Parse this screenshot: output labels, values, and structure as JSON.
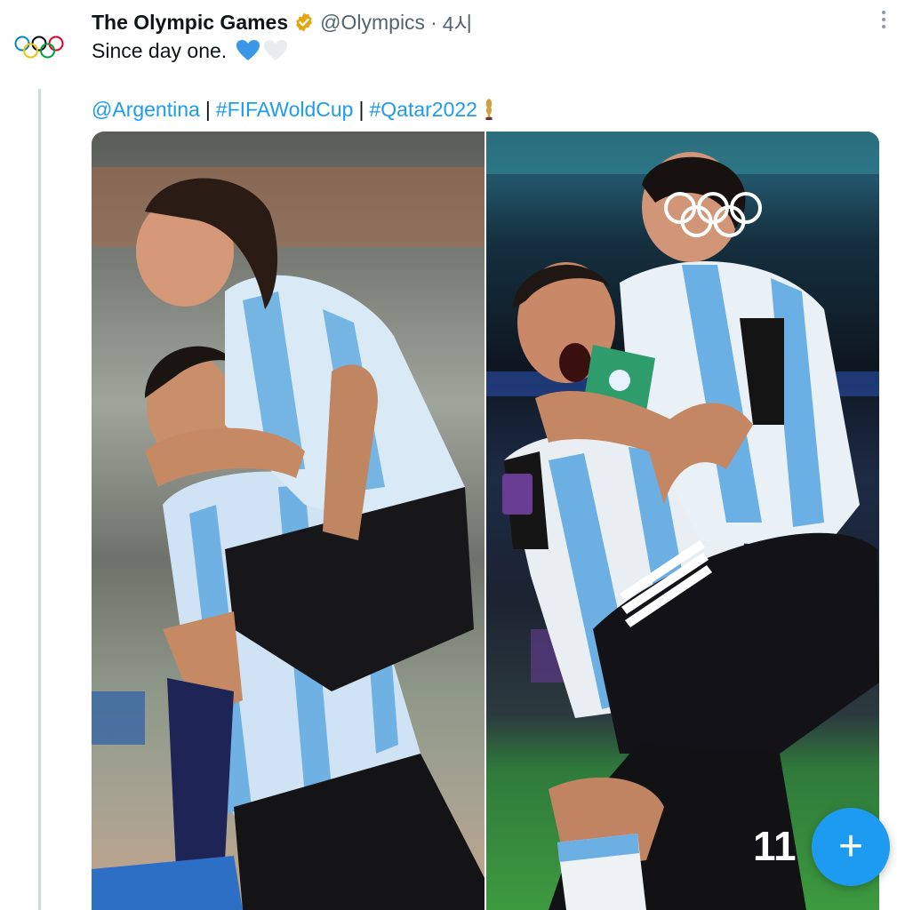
{
  "tweet": {
    "author_name": "The Olympic Games",
    "handle": "@Olympics",
    "separator": "·",
    "time": "4시",
    "text": "Since day one.",
    "emoji_hearts": [
      "blue-heart-icon",
      "white-heart-icon"
    ],
    "mentions": [
      {
        "label": "@Argentina"
      },
      {
        "label": "#FIFAWoldCup"
      },
      {
        "label": "#Qatar2022"
      }
    ],
    "pipe": "|"
  },
  "media": {
    "photos": [
      {
        "name": "photo-2008-celebration"
      },
      {
        "name": "photo-2022-celebration"
      }
    ],
    "jersey_number": "11"
  },
  "compose_button": {
    "label": "+"
  },
  "colors": {
    "accent": "#1d9bf0",
    "verified_badge": "#e2a713",
    "secondary_text": "#536471",
    "thread_line": "#cfd9de"
  }
}
